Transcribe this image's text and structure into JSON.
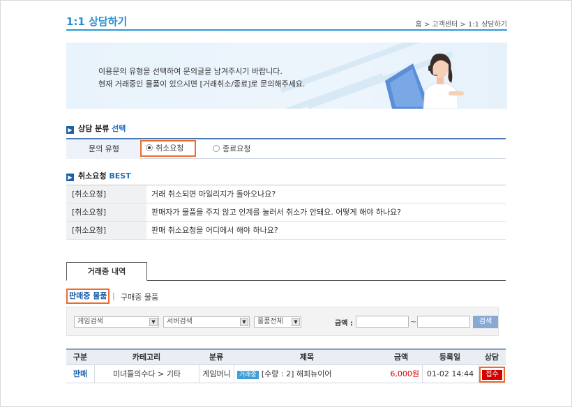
{
  "page": {
    "title": "1:1 상담하기",
    "breadcrumb": "홈 > 고객센터 > 1:1 상담하기",
    "accent_color": "#2a9bd5",
    "highlight_color": "#ee6b2a"
  },
  "banner": {
    "line1": "이용문의 유형을 선택하여 문의글을 남겨주시기 바랍니다.",
    "line2": "현재 거래중인 물품이 있으시면 [거래취소/종료]로 문의해주세요."
  },
  "category": {
    "heading_prefix": "상담 분류 ",
    "heading_accent": "선택",
    "type_label": "문의 유형",
    "options": [
      {
        "label": "취소요청",
        "selected": true
      },
      {
        "label": "종료요청",
        "selected": false
      }
    ]
  },
  "faq": {
    "heading_prefix": "취소요청 ",
    "heading_accent": "BEST",
    "items": [
      {
        "category": "[취소요청]",
        "question": "거래 취소되면 마일리지가 돌아오나요?"
      },
      {
        "category": "[취소요청]",
        "question": "판매자가 물품을 주지 않고 인계를 눌러서 취소가 안돼요. 어떻게 해야 하나요?"
      },
      {
        "category": "[취소요청]",
        "question": "판매 취소요청을 어디에서 해야 하나요?"
      }
    ]
  },
  "trade": {
    "tab_label": "거래중 내역",
    "subtabs": [
      {
        "label": "판매중 물품",
        "selected": true
      },
      {
        "label": "구매중 물품",
        "selected": false
      }
    ],
    "separator": "|"
  },
  "search": {
    "game_select": "게임검색",
    "server_select": "서버검색",
    "item_select": "물품전체",
    "amount_label": "금액 :",
    "tilde": "~",
    "button_label": "검색"
  },
  "results": {
    "columns": [
      "구분",
      "카테고리",
      "분류",
      "제목",
      "금액",
      "등록일",
      "상담"
    ],
    "rows": [
      {
        "kind": "판매",
        "category": "미녀들의수다 > 기타",
        "class": "게임머니",
        "badge": "거래중",
        "title": "[수량 : 2] 해피뉴이어",
        "amount": "6,000원",
        "date": "01-02 14:44",
        "status": "접수"
      }
    ]
  }
}
